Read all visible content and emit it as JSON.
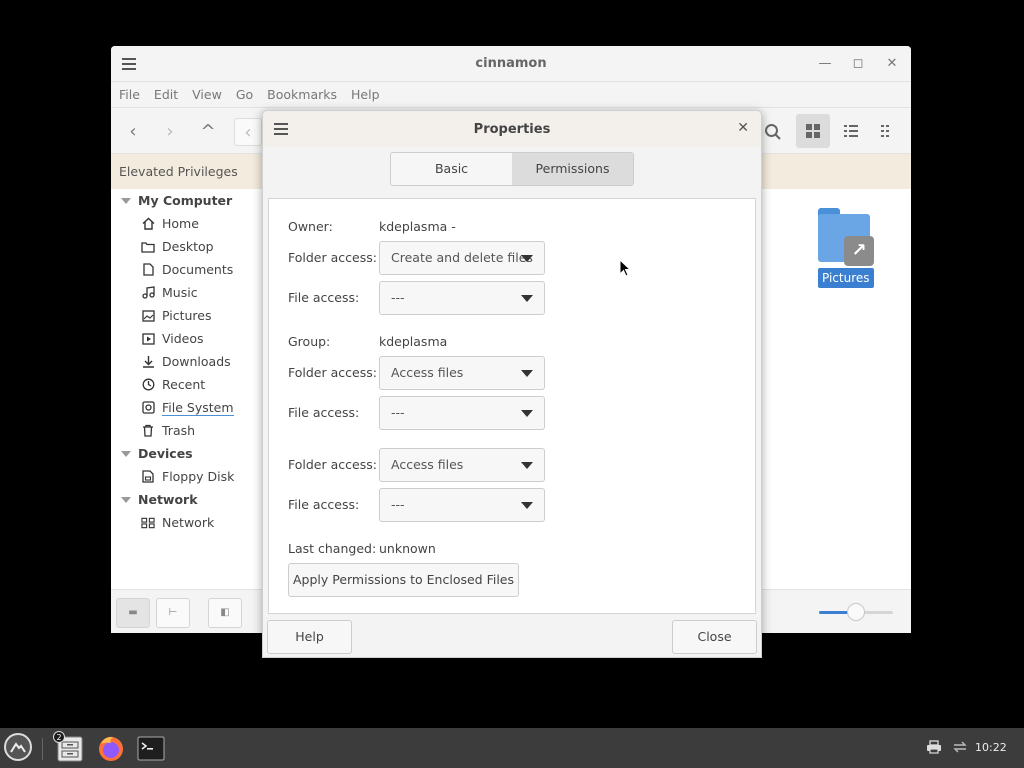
{
  "file_manager": {
    "title": "cinnamon",
    "menu": [
      "File",
      "Edit",
      "View",
      "Go",
      "Bookmarks",
      "Help"
    ],
    "elevated_banner": "Elevated Privileges",
    "sidebar": {
      "my_computer": {
        "header": "My Computer",
        "items": [
          {
            "label": "Home",
            "icon": "home-icon"
          },
          {
            "label": "Desktop",
            "icon": "folder-icon"
          },
          {
            "label": "Documents",
            "icon": "document-icon"
          },
          {
            "label": "Music",
            "icon": "music-icon"
          },
          {
            "label": "Pictures",
            "icon": "picture-icon"
          },
          {
            "label": "Videos",
            "icon": "video-icon"
          },
          {
            "label": "Downloads",
            "icon": "download-icon"
          },
          {
            "label": "Recent",
            "icon": "clock-icon"
          },
          {
            "label": "File System",
            "icon": "drive-icon"
          },
          {
            "label": "Trash",
            "icon": "trash-icon"
          }
        ]
      },
      "devices": {
        "header": "Devices",
        "items": [
          {
            "label": "Floppy Disk",
            "icon": "floppy-icon"
          }
        ]
      },
      "network": {
        "header": "Network",
        "items": [
          {
            "label": "Network",
            "icon": "network-icon"
          }
        ]
      }
    },
    "selected_sidebar_item": "File System",
    "content_items": [
      {
        "label": "Pictures",
        "icon": "folder-link-icon"
      }
    ],
    "zoom_level": 0.5
  },
  "dialog": {
    "title": "Properties",
    "tabs": [
      {
        "label": "Basic"
      },
      {
        "label": "Permissions"
      }
    ],
    "active_tab": "Permissions",
    "owner": {
      "label": "Owner:",
      "value": "kdeplasma -"
    },
    "owner_folder_access": {
      "label": "Folder access:",
      "value": "Create and delete files"
    },
    "owner_file_access": {
      "label": "File access:",
      "value": "---"
    },
    "group": {
      "label": "Group:",
      "value": "kdeplasma"
    },
    "group_folder_access": {
      "label": "Folder access:",
      "value": "Access files"
    },
    "group_file_access": {
      "label": "File access:",
      "value": "---"
    },
    "others_folder_access": {
      "label": "Folder access:",
      "value": "Access files"
    },
    "others_file_access": {
      "label": "File access:",
      "value": "---"
    },
    "last_changed": {
      "label": "Last changed:",
      "value": "unknown"
    },
    "apply_button": "Apply Permissions to Enclosed Files",
    "help_button": "Help",
    "close_button": "Close"
  },
  "taskbar": {
    "file_manager_badge": "2",
    "clock": "10:22"
  }
}
